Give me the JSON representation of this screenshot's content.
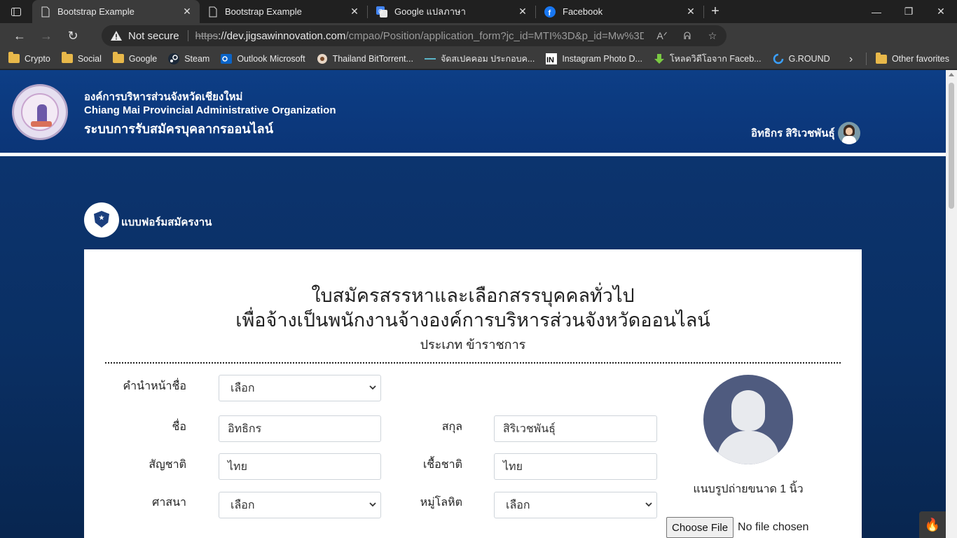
{
  "browser": {
    "tabs": [
      {
        "title": "Bootstrap Example",
        "active": true
      },
      {
        "title": "Bootstrap Example",
        "active": false
      },
      {
        "title": "Google แปลภาษา",
        "active": false
      },
      {
        "title": "Facebook",
        "active": false
      }
    ],
    "address": {
      "security_label": "Not secure",
      "scheme": "https",
      "host": "://dev.jigsawinnovation.com",
      "path": "/cmpao/Position/application_form?jc_id=MTI%3D&p_id=Mw%3D%3..."
    },
    "bookmarks": [
      {
        "label": "Crypto",
        "icon": "folder-icon"
      },
      {
        "label": "Social",
        "icon": "folder-icon"
      },
      {
        "label": "Google",
        "icon": "folder-icon"
      },
      {
        "label": "Steam",
        "icon": "steam-icon"
      },
      {
        "label": "Outlook Microsoft",
        "icon": "outlook-icon"
      },
      {
        "label": "Thailand BitTorrent...",
        "icon": "bittorrent-icon"
      },
      {
        "label": "จัดสเปคคอม ประกอบค...",
        "icon": "site-icon"
      },
      {
        "label": "Instagram Photo D...",
        "icon": "instagram-icon"
      },
      {
        "label": "โหลดวิดีโอจาก Faceb...",
        "icon": "download-icon"
      },
      {
        "label": "G.ROUND",
        "icon": "ground-icon"
      }
    ],
    "other_favorites": "Other favorites"
  },
  "header": {
    "org_th": "องค์การบริหารส่วนจังหวัดเชียงใหม่",
    "org_en": "Chiang Mai Provincial Administrative Organization",
    "system_name": "ระบบการรับสมัครบุคลากรออนไลน์",
    "user_name": "อิทธิกร สิริเวชพันธุ์"
  },
  "section_title": "แบบฟอร์มสมัครงาน",
  "form": {
    "title_line1": "ใบสมัครสรรหาและเลือกสรรบุคคลทั่วไป",
    "title_line2": "เพื่อจ้างเป็นพนักงานจ้างองค์การบริหารส่วนจังหวัดออนไลน์",
    "subtitle": "ประเภท ข้าราชการ",
    "fields": {
      "prefix": {
        "label": "คำนำหน้าชื่อ",
        "value": "เลือก"
      },
      "first_name": {
        "label": "ชื่อ",
        "value": "อิทธิกร"
      },
      "last_name": {
        "label": "สกุล",
        "value": "สิริเวชพันธุ์"
      },
      "nationality": {
        "label": "สัญชาติ",
        "value": "ไทย"
      },
      "race": {
        "label": "เชื้อชาติ",
        "value": "ไทย"
      },
      "religion": {
        "label": "ศาสนา",
        "value": "เลือก"
      },
      "blood_type": {
        "label": "หมู่โลหิต",
        "value": "เลือก"
      }
    },
    "photo_caption": "แนบรูปถ่ายขนาด 1 นิ้ว",
    "file_button": "Choose File",
    "file_status": "No file chosen"
  }
}
